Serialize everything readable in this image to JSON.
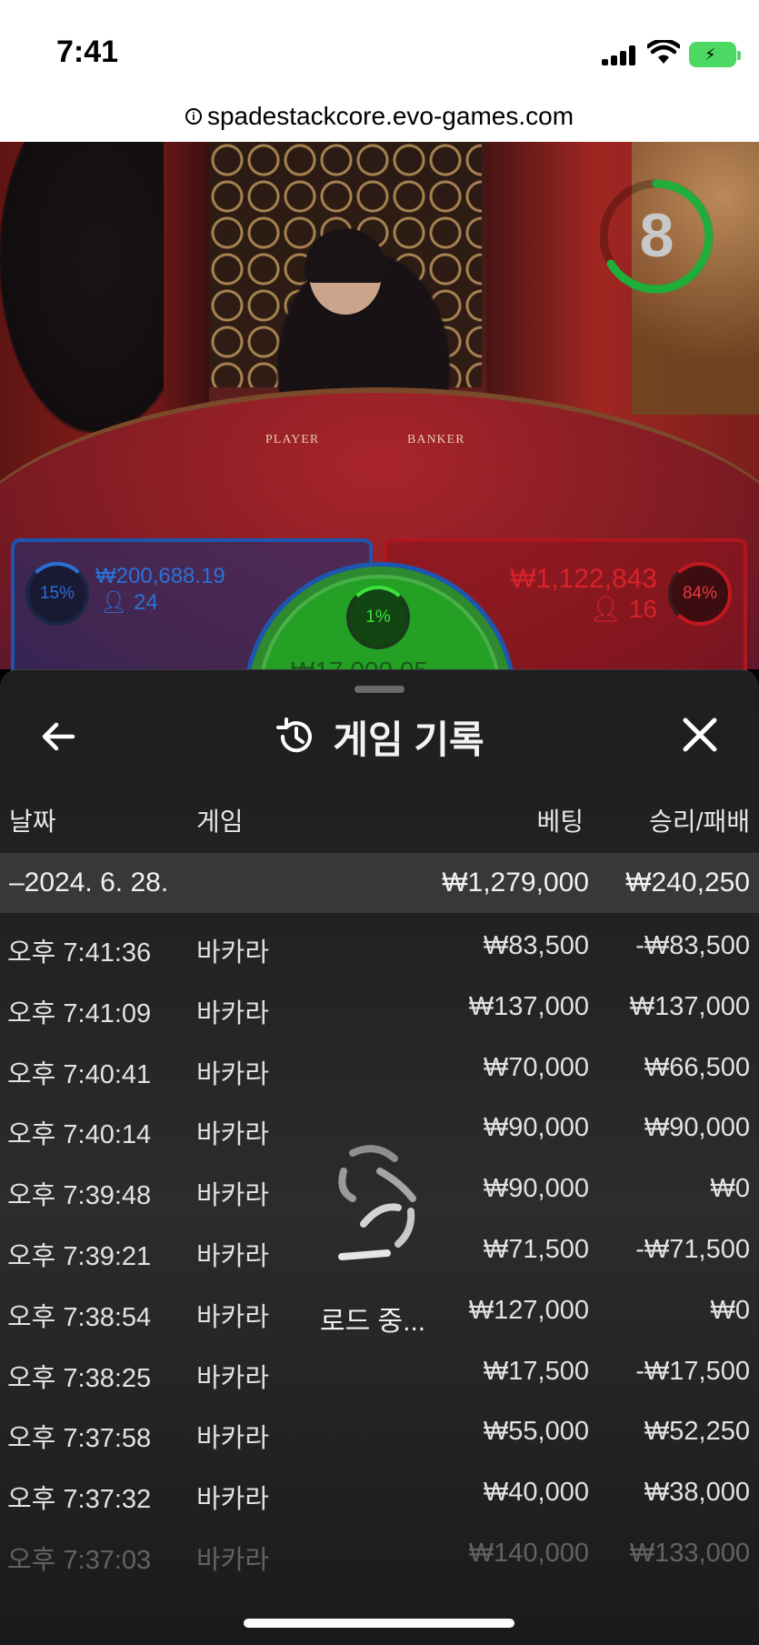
{
  "status_bar": {
    "time": "7:41"
  },
  "browser": {
    "url": "spadestackcore.evo-games.com"
  },
  "game_view": {
    "timer": "8",
    "table_labels": {
      "player": "PLAYER",
      "banker": "BANKER"
    },
    "player": {
      "percent": "15%",
      "amount": "₩200,688.19",
      "players": "24"
    },
    "banker": {
      "percent": "84%",
      "amount": "₩1,122,843",
      "players": "16"
    },
    "tie": {
      "percent": "1%",
      "amount": "₩17,000.05"
    }
  },
  "history": {
    "title": "게임 기록",
    "columns": {
      "date": "날짜",
      "game": "게임",
      "bet": "베팅",
      "win_loss": "승리/패배"
    },
    "day_summary": {
      "date": "–2024. 6. 28.",
      "bet": "₩1,279,000",
      "win_loss": "₩240,250"
    },
    "rows": [
      {
        "time": "오후 7:41:36",
        "game": "바카라",
        "bet": "₩83,500",
        "win_loss": "-₩83,500"
      },
      {
        "time": "오후 7:41:09",
        "game": "바카라",
        "bet": "₩137,000",
        "win_loss": "₩137,000"
      },
      {
        "time": "오후 7:40:41",
        "game": "바카라",
        "bet": "₩70,000",
        "win_loss": "₩66,500"
      },
      {
        "time": "오후 7:40:14",
        "game": "바카라",
        "bet": "₩90,000",
        "win_loss": "₩90,000"
      },
      {
        "time": "오후 7:39:48",
        "game": "바카라",
        "bet": "₩90,000",
        "win_loss": "₩0"
      },
      {
        "time": "오후 7:39:21",
        "game": "바카라",
        "bet": "₩71,500",
        "win_loss": "-₩71,500"
      },
      {
        "time": "오후 7:38:54",
        "game": "바카라",
        "bet": "₩127,000",
        "win_loss": "₩0"
      },
      {
        "time": "오후 7:38:25",
        "game": "바카라",
        "bet": "₩17,500",
        "win_loss": "-₩17,500"
      },
      {
        "time": "오후 7:37:58",
        "game": "바카라",
        "bet": "₩55,000",
        "win_loss": "₩52,250"
      },
      {
        "time": "오후 7:37:32",
        "game": "바카라",
        "bet": "₩40,000",
        "win_loss": "₩38,000"
      },
      {
        "time": "오후 7:37:03",
        "game": "바카라",
        "bet": "₩140,000",
        "win_loss": "₩133,000"
      }
    ],
    "loading_text": "로드 중..."
  },
  "icons": {
    "back": "arrow-left-icon",
    "close": "close-icon",
    "history": "history-icon",
    "loader": "loading-spinner-icon",
    "info": "info-icon"
  },
  "colors": {
    "player_blue": "#2a72d8",
    "banker_red": "#d8222a",
    "tie_green": "#3de03d",
    "timer_ring": "#1fae3a",
    "sheet_bg": "#232325"
  }
}
